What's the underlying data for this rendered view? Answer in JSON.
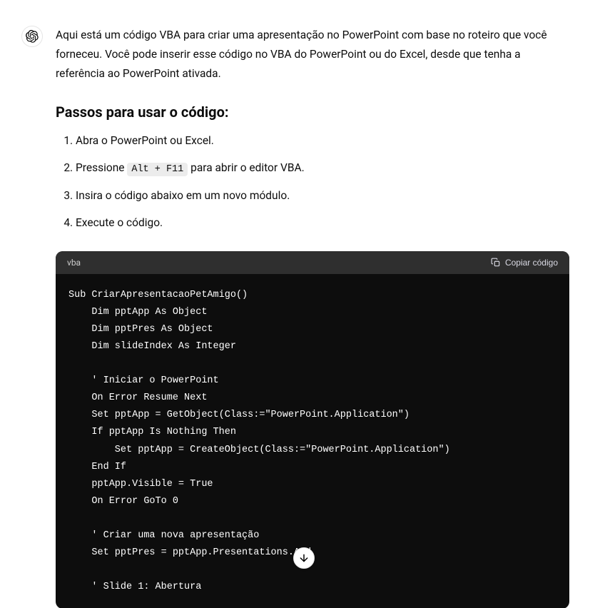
{
  "intro": "Aqui está um código VBA para criar uma apresentação no PowerPoint com base no roteiro que você forneceu. Você pode inserir esse código no VBA do PowerPoint ou do Excel, desde que tenha a referência ao PowerPoint ativada.",
  "heading": "Passos para usar o código:",
  "steps": {
    "s1": "Abra o PowerPoint ou Excel.",
    "s2a": "Pressione ",
    "s2_code": "Alt + F11",
    "s2b": " para abrir o editor VBA.",
    "s3": "Insira o código abaixo em um novo módulo.",
    "s4": "Execute o código."
  },
  "code": {
    "lang": "vba",
    "copy_label": "Copiar código",
    "body": "Sub CriarApresentacaoPetAmigo()\n    Dim pptApp As Object\n    Dim pptPres As Object\n    Dim slideIndex As Integer\n\n    ' Iniciar o PowerPoint\n    On Error Resume Next\n    Set pptApp = GetObject(Class:=\"PowerPoint.Application\")\n    If pptApp Is Nothing Then\n        Set pptApp = CreateObject(Class:=\"PowerPoint.Application\")\n    End If\n    pptApp.Visible = True\n    On Error GoTo 0\n\n    ' Criar uma nova apresentação\n    Set pptPres = pptApp.Presentations.Add\n\n    ' Slide 1: Abertura"
  }
}
